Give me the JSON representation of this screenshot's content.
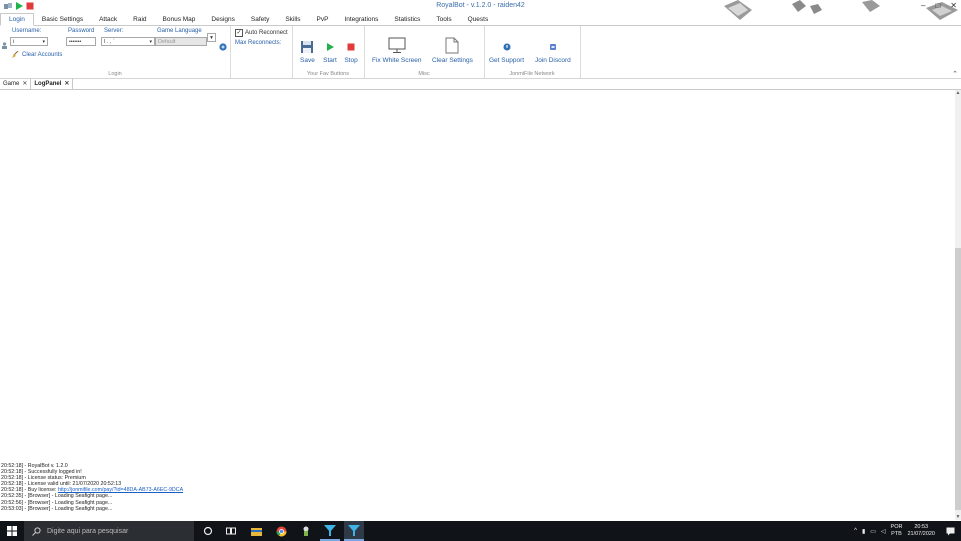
{
  "window": {
    "title": "RoyalBot - v.1.2.0 - raiden42",
    "controls": [
      "–",
      "□",
      "✕"
    ]
  },
  "menu_tabs": [
    "Login",
    "Basic Settings",
    "Attack",
    "Raid",
    "Bonus Map",
    "Designs",
    "Safety",
    "Skills",
    "PvP",
    "Integrations",
    "Statistics",
    "Tools",
    "Quests"
  ],
  "login": {
    "username_label": "Username:",
    "password_label": "Password",
    "server_label": "Server:",
    "language_label": "Game Language",
    "username_value": "i",
    "password_value": "•••••••",
    "server_value": "l  . ,  `",
    "language_value": "Default",
    "clear_accounts": "Clear Accounts",
    "group_label": "Login"
  },
  "reconnect": {
    "auto_reconnect": "Auto Reconnect",
    "max_reconnects": "Max Reconnects:"
  },
  "fav_buttons": {
    "save": "Save",
    "start": "Start",
    "stop": "Stop",
    "group_label": "Your Fav Buttons"
  },
  "misc": {
    "fix_white_screen": "Fix White Screen",
    "clear_settings": "Clear Settings",
    "group_label": "Misc"
  },
  "network": {
    "get_support": "Get Support",
    "join_discord": "Join Discord",
    "group_label": "JonmiFile Network"
  },
  "doc_tabs": [
    {
      "label": "Game"
    },
    {
      "label": "LogPanel"
    }
  ],
  "log": {
    "lines": [
      "20:52:18] - RoyalBot v. 1.2.0",
      "20:52:18] - Successfully logged in!",
      "20:52:18] - License status: Premium",
      "20:52:18] - License valid until: 21/07/2020 20:52:13",
      "20:52:18] - Buy license: ",
      "20:52:35] - [Browser] - Loading Seafight page...",
      "20:52:56] - [Browser] - Loading Seafight page...",
      "20:53:03] - [Browser] - Loading Seafight page..."
    ],
    "license_link": "http://jonmifile.com/pay/?id=48DA-AB73-A6EC-9DCA"
  },
  "taskbar": {
    "search_placeholder": "Digite aqui para pesquisar",
    "lang_top": "POR",
    "lang_bottom": "PTB",
    "time": "20:53",
    "date": "21/07/2020"
  },
  "colors": {
    "accent": "#2860a8",
    "taskbar": "#101418",
    "start_green": "#22b14c",
    "stop_red": "#e03a3a"
  }
}
